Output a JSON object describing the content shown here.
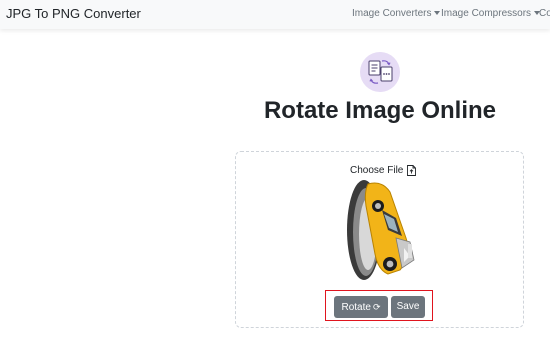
{
  "navbar": {
    "brand": "JPG To PNG Converter",
    "items": [
      {
        "label": "Image Converters",
        "dropdown": true
      },
      {
        "label": "Image Compressors",
        "dropdown": true
      },
      {
        "label": "Co",
        "dropdown": false
      }
    ]
  },
  "page": {
    "title": "Rotate Image Online"
  },
  "upload": {
    "choose_label": "Choose File"
  },
  "buttons": {
    "rotate_label": "Rotate",
    "save_label": "Save"
  },
  "colors": {
    "accent_purple": "#e6dcf5",
    "button_gray": "#6c757d",
    "highlight_red": "#e0141e",
    "car_yellow": "#f2b418"
  },
  "icons": [
    "convert-files-icon",
    "file-upload-icon",
    "rotate-icon",
    "caret-down-icon"
  ]
}
